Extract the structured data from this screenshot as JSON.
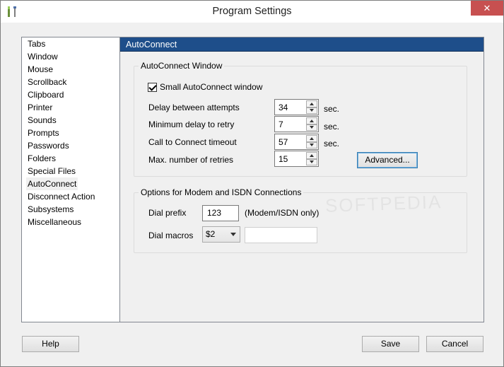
{
  "window": {
    "title": "Program Settings",
    "close_glyph": "✕"
  },
  "sidebar": {
    "items": [
      {
        "label": "Tabs"
      },
      {
        "label": "Window"
      },
      {
        "label": "Mouse"
      },
      {
        "label": "Scrollback"
      },
      {
        "label": "Clipboard"
      },
      {
        "label": "Printer"
      },
      {
        "label": "Sounds"
      },
      {
        "label": "Prompts"
      },
      {
        "label": "Passwords"
      },
      {
        "label": "Folders"
      },
      {
        "label": "Special Files"
      },
      {
        "label": "AutoConnect",
        "selected": true
      },
      {
        "label": "Disconnect Action"
      },
      {
        "label": "Subsystems"
      },
      {
        "label": "Miscellaneous"
      }
    ]
  },
  "panel": {
    "title": "AutoConnect",
    "autoconnect_group": {
      "title": "AutoConnect Window",
      "small_window": {
        "label": "Small AutoConnect window",
        "checked": true
      },
      "delay_between": {
        "label": "Delay between attempts",
        "value": "34",
        "unit": "sec."
      },
      "min_delay": {
        "label": "Minimum delay to retry",
        "value": "7",
        "unit": "sec."
      },
      "call_timeout": {
        "label": "Call to Connect timeout",
        "value": "57",
        "unit": "sec."
      },
      "max_retries": {
        "label": "Max. number of retries",
        "value": "15"
      },
      "advanced_label": "Advanced..."
    },
    "modem_group": {
      "title": "Options for Modem and ISDN Connections",
      "dial_prefix": {
        "label": "Dial prefix",
        "value": "123",
        "note": "(Modem/ISDN only)"
      },
      "dial_macros": {
        "label": "Dial macros",
        "selected": "$2",
        "text": ""
      }
    }
  },
  "footer": {
    "help_label": "Help",
    "save_label": "Save",
    "cancel_label": "Cancel"
  },
  "watermark_text": "SOFTPEDIA",
  "colors": {
    "header_bg": "#1e4e8a",
    "close_bg": "#c75050"
  },
  "icons": {
    "app": "tools-icon",
    "close": "close-icon"
  }
}
